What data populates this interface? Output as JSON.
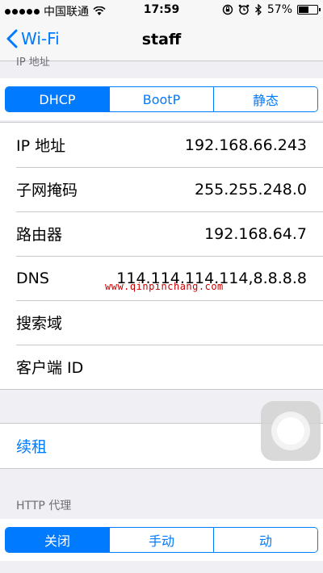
{
  "status_bar": {
    "carrier": "中国联通",
    "time": "17:59",
    "battery_percent": "57%",
    "battery_level": 0.57,
    "icons": [
      "signal-dots-icon",
      "wifi-icon",
      "rotation-lock-icon",
      "alarm-icon",
      "bluetooth-icon",
      "battery-icon"
    ]
  },
  "nav": {
    "back_label": "Wi-Fi",
    "title": "staff"
  },
  "ip_section": {
    "header": "IP 地址",
    "modes": [
      {
        "label": "DHCP",
        "active": true
      },
      {
        "label": "BootP",
        "active": false
      },
      {
        "label": "静态",
        "active": false
      }
    ],
    "rows": [
      {
        "label": "IP 地址",
        "value": "192.168.66.243"
      },
      {
        "label": "子网掩码",
        "value": "255.255.248.0"
      },
      {
        "label": "路由器",
        "value": "192.168.64.7"
      },
      {
        "label": "DNS",
        "value": "114.114.114.114,8.8.8.8"
      },
      {
        "label": "搜索域",
        "value": ""
      },
      {
        "label": "客户端 ID",
        "value": ""
      }
    ]
  },
  "renew": {
    "label": "续租"
  },
  "proxy_section": {
    "header": "HTTP 代理",
    "modes": [
      {
        "label": "关闭",
        "active": true
      },
      {
        "label": "手动",
        "active": false
      },
      {
        "label": "动",
        "active": false
      }
    ]
  },
  "watermark": "www.qinpinchang.com",
  "colors": {
    "accent": "#007aff",
    "background": "#efeff4",
    "separator": "#c8c7cc"
  }
}
